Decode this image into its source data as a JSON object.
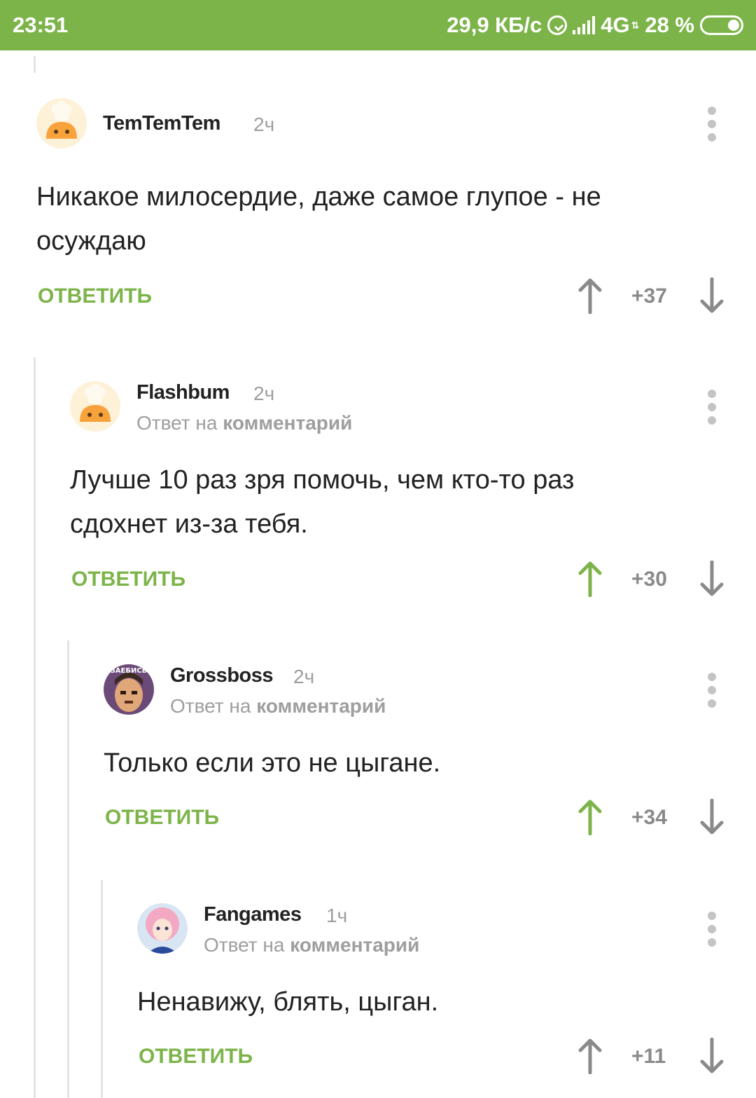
{
  "status_bar": {
    "time": "23:51",
    "speed": "29,9 КБ/с",
    "network": "4G",
    "battery": "28 %"
  },
  "colors": {
    "accent": "#7db44a",
    "muted": "#9e9e9e",
    "vote_neutral": "#8a8a8a"
  },
  "comments": [
    {
      "username": "TemTemTem",
      "time": "2ч",
      "reply_prefix": "",
      "reply_target": "",
      "text": "Никакое милосердие, даже самое глупое - не осуждаю",
      "reply_label": "ОТВЕТИТЬ",
      "score": "+37",
      "upvoted": false,
      "avatar": "default-chef-avatar"
    },
    {
      "username": "Flashbum",
      "time": "2ч",
      "reply_prefix": "Ответ на ",
      "reply_target": "комментарий",
      "text": "Лучше 10 раз зря помочь, чем кто-то раз сдохнет из-за тебя.",
      "reply_label": "ОТВЕТИТЬ",
      "score": "+30",
      "upvoted": true,
      "avatar": "default-chef-avatar"
    },
    {
      "username": "Grossboss",
      "time": "2ч",
      "reply_prefix": "Ответ на ",
      "reply_target": "комментарий",
      "text": "Только если это не цыгане.",
      "reply_label": "ОТВЕТИТЬ",
      "score": "+34",
      "upvoted": true,
      "avatar": "cartoon-man-avatar",
      "avatar_caption": "ЗАЕБИСЬ"
    },
    {
      "username": "Fangames",
      "time": "1ч",
      "reply_prefix": "Ответ на ",
      "reply_target": "комментарий",
      "text": "Ненавижу, блять, цыган.",
      "reply_label": "ОТВЕТИТЬ",
      "score": "+11",
      "upvoted": false,
      "avatar": "anime-girl-avatar"
    }
  ]
}
